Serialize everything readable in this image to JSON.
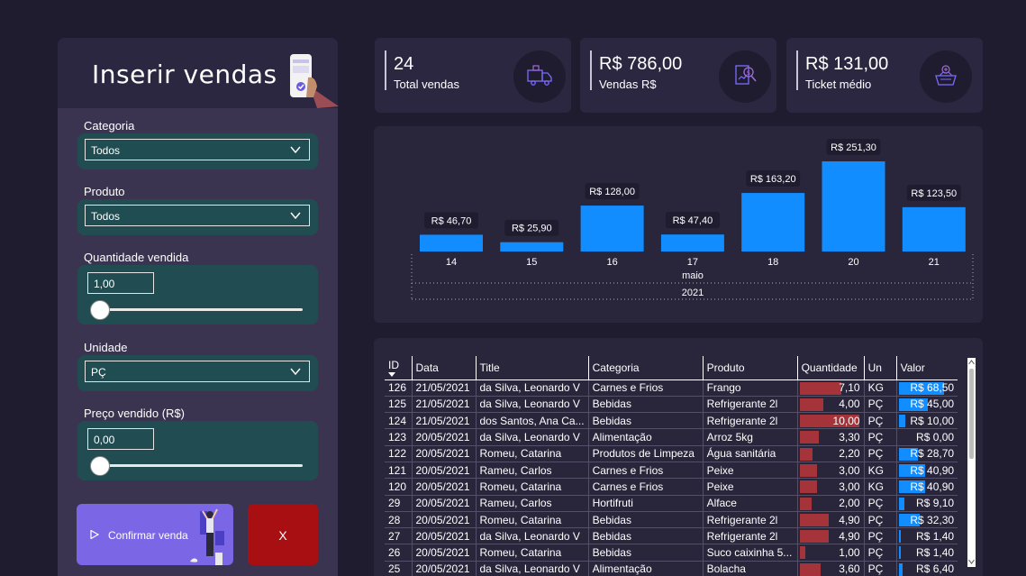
{
  "form": {
    "title": "Inserir vendas",
    "categoria": {
      "label": "Categoria",
      "value": "Todos"
    },
    "produto": {
      "label": "Produto",
      "value": "Todos"
    },
    "quantidade": {
      "label": "Quantidade vendida",
      "value": "1,00"
    },
    "unidade": {
      "label": "Unidade",
      "value": "PÇ"
    },
    "preco": {
      "label": "Preço vendido (R$)",
      "value": "0,00"
    },
    "confirm_label": "Confirmar venda",
    "cancel_label": "X"
  },
  "kpis": [
    {
      "value": "24",
      "label": "Total vendas",
      "icon": "delivery-truck-icon"
    },
    {
      "value": "R$ 786,00",
      "label": "Vendas R$",
      "icon": "money-report-icon"
    },
    {
      "value": "R$ 131,00",
      "label": "Ticket médio",
      "icon": "shopping-basket-icon"
    }
  ],
  "colors": {
    "bar": "#118dff",
    "qty_bar": "#a4343a",
    "val_bar": "#118dff",
    "accent": "#7b66e6",
    "danger": "#a80f13"
  },
  "chart_data": {
    "type": "bar",
    "categories": [
      "14",
      "15",
      "16",
      "17",
      "18",
      "20",
      "21"
    ],
    "values": [
      46.7,
      25.9,
      128.0,
      47.4,
      163.2,
      251.3,
      123.5
    ],
    "data_labels": [
      "R$ 46,70",
      "R$ 25,90",
      "R$ 128,00",
      "R$ 47,40",
      "R$ 163,20",
      "R$ 251,30",
      "R$ 123,50"
    ],
    "month_label": "maio",
    "year_label": "2021",
    "grid": false
  },
  "table": {
    "columns": [
      "ID",
      "Data",
      "Title",
      "Categoria",
      "Produto",
      "Quantidade",
      "Un",
      "Valor"
    ],
    "rows": [
      {
        "id": "126",
        "data": "21/05/2021",
        "title": "da Silva, Leonardo V",
        "categoria": "Carnes e Frios",
        "produto": "Frango",
        "qtd": 7.1,
        "qtd_text": "7,10",
        "un": "KG",
        "valor": 68.5,
        "valor_text": "R$ 68,50"
      },
      {
        "id": "125",
        "data": "21/05/2021",
        "title": "da Silva, Leonardo V",
        "categoria": "Bebidas",
        "produto": "Refrigerante 2l",
        "qtd": 4.0,
        "qtd_text": "4,00",
        "un": "PÇ",
        "valor": 45.0,
        "valor_text": "R$ 45,00"
      },
      {
        "id": "124",
        "data": "21/05/2021",
        "title": "dos Santos, Ana Ca...",
        "categoria": "Bebidas",
        "produto": "Refrigerante 2l",
        "qtd": 10.0,
        "qtd_text": "10,00",
        "un": "PÇ",
        "valor": 10.0,
        "valor_text": "R$ 10,00"
      },
      {
        "id": "123",
        "data": "20/05/2021",
        "title": "da Silva, Leonardo V",
        "categoria": "Alimentação",
        "produto": "Arroz 5kg",
        "qtd": 3.3,
        "qtd_text": "3,30",
        "un": "PÇ",
        "valor": 0.0,
        "valor_text": "R$ 0,00"
      },
      {
        "id": "122",
        "data": "20/05/2021",
        "title": "Romeu, Catarina",
        "categoria": "Produtos de Limpeza",
        "produto": "Água sanitária",
        "qtd": 2.2,
        "qtd_text": "2,20",
        "un": "PÇ",
        "valor": 28.7,
        "valor_text": "R$ 28,70"
      },
      {
        "id": "121",
        "data": "20/05/2021",
        "title": "Rameu, Carlos",
        "categoria": "Carnes e Frios",
        "produto": "Peixe",
        "qtd": 3.0,
        "qtd_text": "3,00",
        "un": "KG",
        "valor": 40.9,
        "valor_text": "R$ 40,90"
      },
      {
        "id": "120",
        "data": "20/05/2021",
        "title": "Romeu, Catarina",
        "categoria": "Carnes e Frios",
        "produto": "Peixe",
        "qtd": 3.0,
        "qtd_text": "3,00",
        "un": "KG",
        "valor": 40.9,
        "valor_text": "R$ 40,90"
      },
      {
        "id": "29",
        "data": "20/05/2021",
        "title": "Rameu, Carlos",
        "categoria": "Hortifruti",
        "produto": "Alface",
        "qtd": 2.0,
        "qtd_text": "2,00",
        "un": "PÇ",
        "valor": 9.1,
        "valor_text": "R$ 9,10"
      },
      {
        "id": "28",
        "data": "20/05/2021",
        "title": "Romeu, Catarina",
        "categoria": "Bebidas",
        "produto": "Refrigerante 2l",
        "qtd": 4.9,
        "qtd_text": "4,90",
        "un": "PÇ",
        "valor": 32.3,
        "valor_text": "R$ 32,30"
      },
      {
        "id": "27",
        "data": "20/05/2021",
        "title": "da Silva, Leonardo V",
        "categoria": "Bebidas",
        "produto": "Refrigerante 2l",
        "qtd": 4.9,
        "qtd_text": "4,90",
        "un": "PÇ",
        "valor": 1.4,
        "valor_text": "R$ 1,40"
      },
      {
        "id": "26",
        "data": "20/05/2021",
        "title": "Romeu, Catarina",
        "categoria": "Bebidas",
        "produto": "Suco caixinha 5...",
        "qtd": 1.0,
        "qtd_text": "1,00",
        "un": "PÇ",
        "valor": 1.4,
        "valor_text": "R$ 1,40"
      },
      {
        "id": "25",
        "data": "20/05/2021",
        "title": "da Silva, Leonardo V",
        "categoria": "Alimentação",
        "produto": "Bolacha",
        "qtd": 3.6,
        "qtd_text": "3,60",
        "un": "PÇ",
        "valor": 6.4,
        "valor_text": "R$ 6,40"
      }
    ]
  }
}
